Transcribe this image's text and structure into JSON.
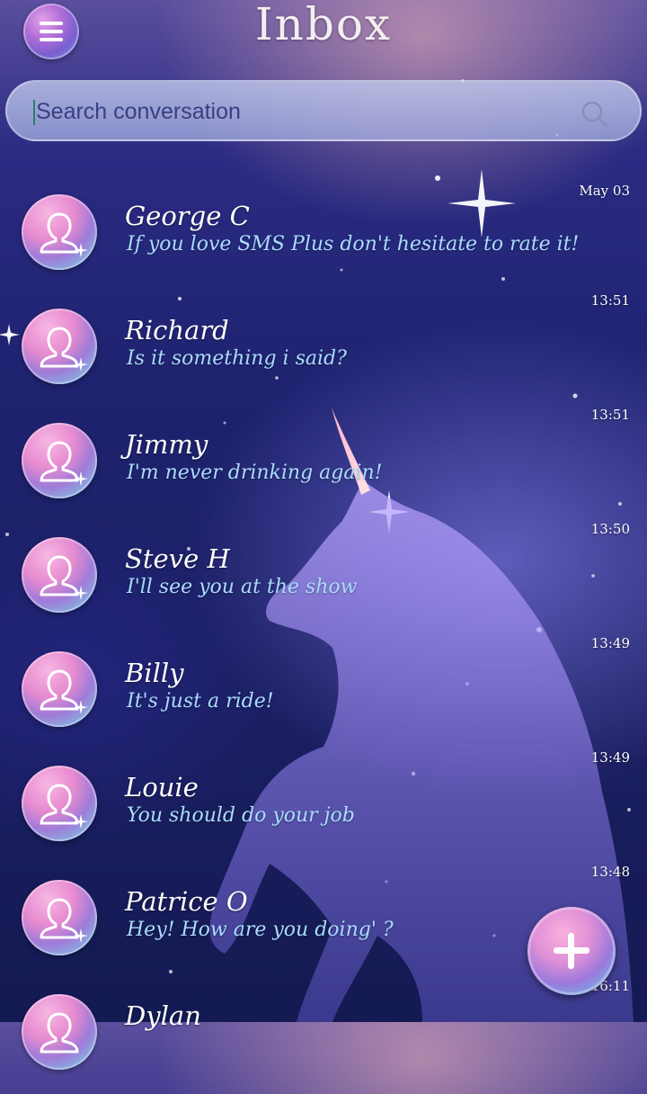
{
  "header": {
    "title": "Inbox"
  },
  "search": {
    "placeholder": "Search conversation"
  },
  "conversations": [
    {
      "name": "George C",
      "snippet": "If you love SMS Plus don't hesitate to rate it!",
      "time": "May 03"
    },
    {
      "name": "Richard",
      "snippet": "Is it something i said?",
      "time": "13:51"
    },
    {
      "name": "Jimmy",
      "snippet": "I'm never drinking again!",
      "time": "13:51"
    },
    {
      "name": "Steve H",
      "snippet": "I'll see you at the show",
      "time": "13:50"
    },
    {
      "name": "Billy",
      "snippet": "It's just a ride!",
      "time": "13:49"
    },
    {
      "name": "Louie",
      "snippet": "You should do your job",
      "time": "13:49"
    },
    {
      "name": "Patrice O",
      "snippet": "Hey! How are you doing' ?",
      "time": "13:48"
    },
    {
      "name": "Dylan",
      "snippet": "",
      "time": "16:11"
    }
  ],
  "theme": {
    "accent": "#e78bd0",
    "snippet_color": "#a9dcff"
  },
  "icons": {
    "menu": "hamburger-icon",
    "search": "search-icon",
    "avatar": "person-icon",
    "compose": "plus-icon"
  }
}
